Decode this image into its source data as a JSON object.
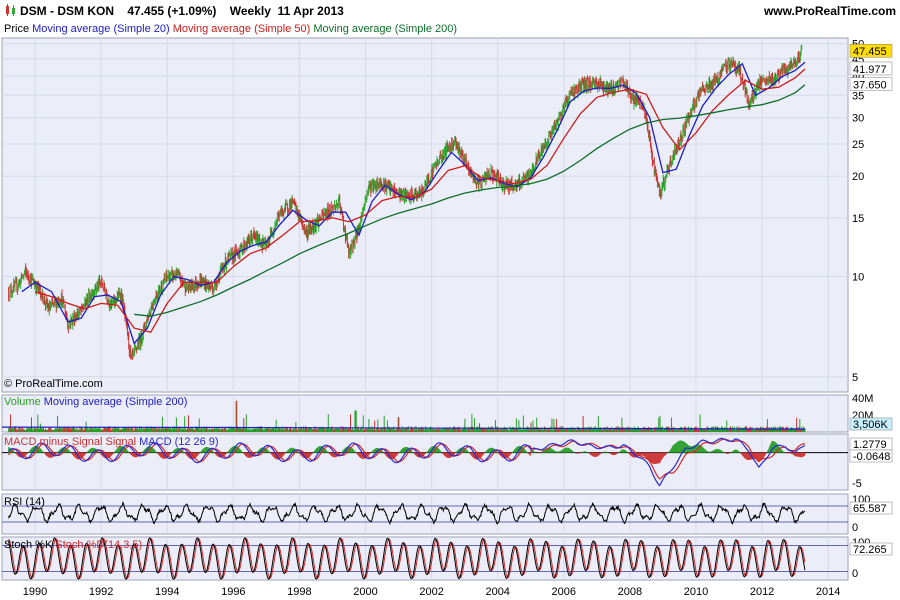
{
  "header": {
    "title": "DSM - DSM KON",
    "last": "47.455",
    "change": "(+1.09%)",
    "period": "Weekly",
    "date": "11 Apr 2013",
    "site": "www.ProRealTime.com"
  },
  "colors": {
    "panel_bg": "#ebedf8",
    "price_up": "#33a833",
    "price_down": "#cc3333",
    "ma20": "#1c1cc8",
    "ma50": "#cc1c1c",
    "ma200": "#0f6e2a",
    "volume": "#2aa02a",
    "macd": "#2a2ad0",
    "signal": "#d02a2a",
    "rsi": "#000000"
  },
  "chart_data": [
    {
      "type": "line",
      "panel": "price",
      "scale": "log",
      "legend": [
        "Price",
        "Moving average (Simple 20)",
        "Moving average (Simple 50)",
        "Moving average (Simple 200)"
      ],
      "ylim": [
        4.5,
        52
      ],
      "yticks": [
        5,
        10,
        15,
        20,
        25,
        30,
        35,
        40,
        45,
        50
      ],
      "xticks": [
        "1990",
        "1992",
        "1994",
        "1996",
        "1998",
        "2000",
        "2002",
        "2004",
        "2006",
        "2008",
        "2010",
        "2012",
        "2014"
      ],
      "xlim": [
        1989.0,
        2014.6
      ],
      "value_labels": {
        "price": "47.455",
        "ma50": "41.977",
        "ma200": "37.650"
      },
      "series": [
        {
          "name": "Price",
          "x": [
            1989.2,
            1989.5,
            1989.7,
            1990.1,
            1990.4,
            1990.8,
            1991.0,
            1991.4,
            1991.7,
            1992.0,
            1992.3,
            1992.6,
            1992.9,
            1993.2,
            1993.6,
            1994.0,
            1994.3,
            1994.6,
            1995.0,
            1995.4,
            1995.8,
            1996.2,
            1996.6,
            1997.0,
            1997.4,
            1997.8,
            1998.2,
            1998.5,
            1998.9,
            1999.2,
            1999.5,
            1999.8,
            2000.1,
            2000.5,
            2000.9,
            2001.3,
            2001.7,
            2002.1,
            2002.4,
            2002.7,
            2003.1,
            2003.4,
            2003.8,
            2004.2,
            2004.6,
            2005.0,
            2005.4,
            2005.8,
            2006.2,
            2006.6,
            2007.0,
            2007.4,
            2007.8,
            2008.1,
            2008.4,
            2008.7,
            2008.9,
            2009.2,
            2009.5,
            2009.8,
            2010.2,
            2010.6,
            2011.0,
            2011.3,
            2011.6,
            2011.9,
            2012.3,
            2012.6,
            2012.9,
            2013.2
          ],
          "values": [
            9.0,
            9.5,
            10.3,
            9.2,
            8.0,
            8.6,
            7.2,
            7.9,
            8.9,
            9.6,
            8.2,
            8.9,
            5.6,
            6.5,
            8.5,
            10.0,
            10.1,
            9.2,
            9.7,
            9.2,
            11.2,
            12.0,
            13.2,
            12.3,
            15.4,
            16.7,
            13.5,
            14.5,
            15.8,
            16.6,
            11.6,
            14.0,
            18.6,
            19.1,
            17.9,
            17.3,
            17.8,
            21.5,
            23.7,
            25.6,
            21.0,
            19.0,
            20.4,
            18.8,
            18.8,
            20.3,
            24.6,
            29.0,
            35.5,
            37.6,
            38.2,
            36.4,
            38.4,
            34.1,
            32.5,
            22.0,
            17.5,
            21.5,
            25.5,
            30.5,
            36.5,
            38.5,
            44.0,
            42.0,
            32.5,
            38.0,
            38.8,
            41.0,
            42.5,
            47.455
          ]
        },
        {
          "name": "Moving average (Simple 20)",
          "x": [
            1989.6,
            1990.0,
            1990.5,
            1991.0,
            1991.4,
            1991.8,
            1992.2,
            1992.6,
            1993.0,
            1993.4,
            1993.8,
            1994.2,
            1994.6,
            1995.0,
            1995.4,
            1995.8,
            1996.2,
            1996.6,
            1997.0,
            1997.4,
            1997.8,
            1998.2,
            1998.6,
            1999.0,
            1999.4,
            1999.8,
            2000.2,
            2000.6,
            2001.0,
            2001.4,
            2001.8,
            2002.2,
            2002.6,
            2003.0,
            2003.4,
            2003.8,
            2004.2,
            2004.6,
            2005.0,
            2005.4,
            2005.8,
            2006.2,
            2006.6,
            2007.0,
            2007.4,
            2007.8,
            2008.2,
            2008.6,
            2009.0,
            2009.4,
            2009.8,
            2010.2,
            2010.6,
            2011.0,
            2011.4,
            2011.8,
            2012.2,
            2012.6,
            2013.0,
            2013.3
          ],
          "values": [
            9.0,
            9.6,
            9.0,
            7.3,
            7.5,
            8.7,
            8.8,
            8.4,
            6.3,
            7.0,
            8.8,
            10.0,
            9.8,
            9.4,
            9.6,
            11.0,
            11.9,
            12.4,
            12.7,
            14.3,
            15.8,
            14.8,
            14.2,
            15.6,
            15.6,
            13.3,
            16.8,
            18.8,
            17.6,
            17.0,
            18.0,
            20.7,
            23.6,
            21.7,
            19.4,
            19.8,
            19.0,
            18.6,
            19.8,
            23.0,
            27.5,
            33.5,
            36.0,
            36.8,
            36.7,
            37.5,
            35.4,
            30.0,
            20.5,
            21.0,
            26.5,
            32.5,
            36.8,
            40.5,
            43.5,
            35.0,
            36.8,
            39.8,
            41.5,
            44.0
          ]
        },
        {
          "name": "Moving average (Simple 50)",
          "x": [
            1990.0,
            1990.5,
            1991.0,
            1991.5,
            1992.0,
            1992.5,
            1993.0,
            1993.5,
            1994.0,
            1994.5,
            1995.0,
            1995.5,
            1996.0,
            1996.5,
            1997.0,
            1997.5,
            1998.0,
            1998.5,
            1999.0,
            1999.5,
            2000.0,
            2000.5,
            2001.0,
            2001.5,
            2002.0,
            2002.5,
            2003.0,
            2003.5,
            2004.0,
            2004.5,
            2005.0,
            2005.5,
            2006.0,
            2006.5,
            2007.0,
            2007.5,
            2008.0,
            2008.5,
            2009.0,
            2009.5,
            2010.0,
            2010.5,
            2011.0,
            2011.5,
            2012.0,
            2012.5,
            2013.0,
            2013.3
          ],
          "values": [
            9.0,
            8.7,
            8.3,
            8.0,
            8.3,
            8.2,
            7.0,
            6.8,
            8.3,
            9.6,
            9.6,
            9.6,
            10.7,
            11.7,
            12.2,
            13.3,
            14.6,
            14.7,
            15.0,
            14.6,
            15.3,
            16.9,
            17.4,
            17.3,
            18.3,
            20.8,
            21.5,
            19.8,
            19.4,
            19.0,
            19.6,
            21.6,
            26.0,
            30.8,
            34.5,
            35.7,
            36.5,
            35.2,
            28.0,
            24.0,
            27.0,
            31.5,
            35.2,
            38.8,
            36.5,
            37.0,
            39.5,
            41.977
          ]
        },
        {
          "name": "Moving average (Simple 200)",
          "x": [
            1993.0,
            1993.5,
            1994.0,
            1994.5,
            1995.0,
            1995.5,
            1996.0,
            1996.5,
            1997.0,
            1997.5,
            1998.0,
            1998.5,
            1999.0,
            1999.5,
            2000.0,
            2000.5,
            2001.0,
            2001.5,
            2002.0,
            2002.5,
            2003.0,
            2003.5,
            2004.0,
            2004.5,
            2005.0,
            2005.5,
            2006.0,
            2006.5,
            2007.0,
            2007.5,
            2008.0,
            2008.5,
            2009.0,
            2009.5,
            2010.0,
            2010.5,
            2011.0,
            2011.5,
            2012.0,
            2012.5,
            2013.0,
            2013.3
          ],
          "values": [
            7.7,
            7.6,
            7.8,
            8.1,
            8.4,
            8.8,
            9.3,
            9.8,
            10.4,
            11.0,
            11.7,
            12.3,
            12.9,
            13.5,
            14.2,
            14.9,
            15.5,
            16.0,
            16.5,
            17.2,
            17.8,
            18.2,
            18.5,
            18.7,
            19.0,
            19.6,
            20.7,
            22.3,
            24.2,
            26.0,
            27.7,
            28.9,
            29.6,
            29.9,
            30.4,
            31.0,
            31.7,
            32.3,
            32.8,
            33.8,
            35.6,
            37.65
          ]
        }
      ]
    },
    {
      "type": "bar",
      "panel": "volume",
      "legend": [
        "Volume",
        "Moving average (Simple 200)"
      ],
      "yticks": [
        "40M",
        "20M"
      ],
      "value_label": "3,506K",
      "ylim": [
        0,
        45
      ],
      "unit": "M",
      "peaks": {
        "x": [
          1996.1,
          1999.7,
          2001.0
        ],
        "values": [
          38,
          26,
          18
        ]
      },
      "ma200": {
        "x": [
          1989.0,
          1996.0,
          2004.0,
          2013.3
        ],
        "values": [
          6.0,
          5.5,
          4.5,
          3.5
        ]
      }
    },
    {
      "type": "line",
      "panel": "macd",
      "legend": [
        "MACD minus Signal",
        "Signal",
        "MACD (12 26 9)"
      ],
      "yticks": [
        "-5"
      ],
      "value_labels": {
        "macd": "1.2779",
        "hist": "-0.0648"
      },
      "ylim": [
        -5.2,
        2.6
      ],
      "series": [
        {
          "name": "MACD (12 26 9)",
          "x": [
            2005.0,
            2005.8,
            2006.3,
            2006.8,
            2007.3,
            2007.8,
            2008.3,
            2008.6,
            2008.9,
            2009.3,
            2009.7,
            2010.2,
            2010.7,
            2011.2,
            2011.6,
            2011.9,
            2012.3,
            2012.7,
            2013.0,
            2013.3
          ],
          "values": [
            0.3,
            1.2,
            1.6,
            0.9,
            0.7,
            1.0,
            -0.6,
            -2.0,
            -4.6,
            -2.0,
            0.5,
            1.5,
            1.7,
            1.9,
            0.4,
            -2.3,
            0.6,
            1.0,
            -0.2,
            1.2779
          ]
        },
        {
          "name": "Signal",
          "x": [
            2005.0,
            2005.8,
            2006.3,
            2006.8,
            2007.3,
            2007.8,
            2008.3,
            2008.6,
            2008.9,
            2009.3,
            2009.7,
            2010.2,
            2010.7,
            2011.2,
            2011.6,
            2011.9,
            2012.3,
            2012.7,
            2013.0,
            2013.3
          ],
          "values": [
            0.2,
            0.9,
            1.4,
            1.1,
            0.8,
            0.9,
            -0.2,
            -1.4,
            -3.5,
            -2.8,
            -0.4,
            1.1,
            1.6,
            1.8,
            0.9,
            -1.4,
            -0.3,
            0.8,
            0.3,
            1.3427
          ]
        }
      ]
    },
    {
      "type": "line",
      "panel": "rsi",
      "legend": [
        "RSI (14)"
      ],
      "yticks": [
        "100",
        "0"
      ],
      "value_label": "65.587",
      "ylim": [
        0,
        100
      ],
      "levels": [
        70,
        30
      ]
    },
    {
      "type": "line",
      "panel": "stochastic",
      "legend": [
        "Stoch %K",
        "Stoch %D(14,3,5)"
      ],
      "yticks": [
        "100",
        "0"
      ],
      "value_label": "72.265",
      "ylim": [
        0,
        100
      ],
      "levels": [
        80,
        20
      ]
    }
  ],
  "footer": {
    "copyright": "© ProRealTime.com"
  }
}
